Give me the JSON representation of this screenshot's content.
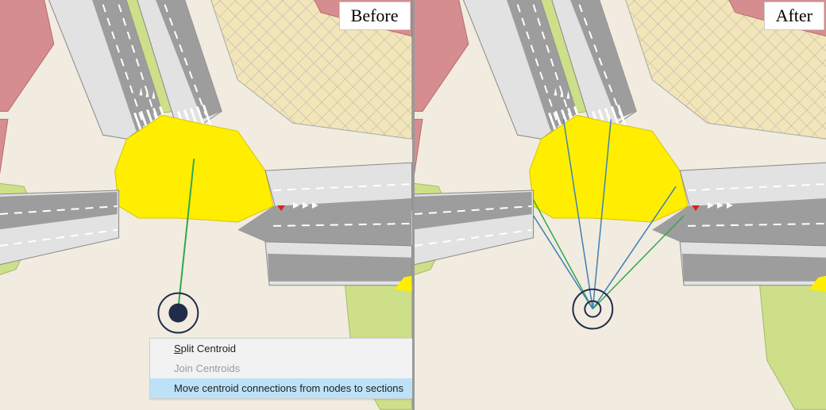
{
  "labels": {
    "before": "Before",
    "after": "After"
  },
  "context_menu": {
    "items": [
      {
        "label": "Split Centroid",
        "enabled": true,
        "underline_first": "S"
      },
      {
        "label": "Join Centroids",
        "enabled": false
      },
      {
        "label": "Move centroid connections from nodes to sections",
        "enabled": true,
        "hover": true
      }
    ]
  },
  "colors": {
    "land": "#f1ecdf",
    "green": "#cddf88",
    "building": "#d58d8f",
    "building_dark": "#b46c70",
    "hatched_bg": "#f2e5b8",
    "hatch_line": "#b0b0b0",
    "road_light": "#e2e2e2",
    "road_dark": "#9d9d9d",
    "intersection": "#ffee00",
    "lane_line": "#ffffff",
    "centroid_ring": "#1f2d4a",
    "centroid_fill": "#1f2d4a",
    "conn_green": "#2fa84f",
    "conn_blue": "#3f7fb8"
  },
  "map_state": {
    "before": {
      "centroid_filled": true,
      "connections": [
        {
          "from": "centroid",
          "to": "node",
          "style": "green"
        }
      ]
    },
    "after": {
      "centroid_filled": false,
      "connections": [
        {
          "from": "centroid",
          "to": "section-w",
          "style": "green"
        },
        {
          "from": "centroid",
          "to": "section-nw",
          "style": "blue"
        },
        {
          "from": "centroid",
          "to": "section-n1",
          "style": "blue"
        },
        {
          "from": "centroid",
          "to": "section-n2",
          "style": "blue"
        },
        {
          "from": "centroid",
          "to": "section-ne",
          "style": "blue"
        },
        {
          "from": "centroid",
          "to": "section-e",
          "style": "green"
        }
      ]
    }
  }
}
